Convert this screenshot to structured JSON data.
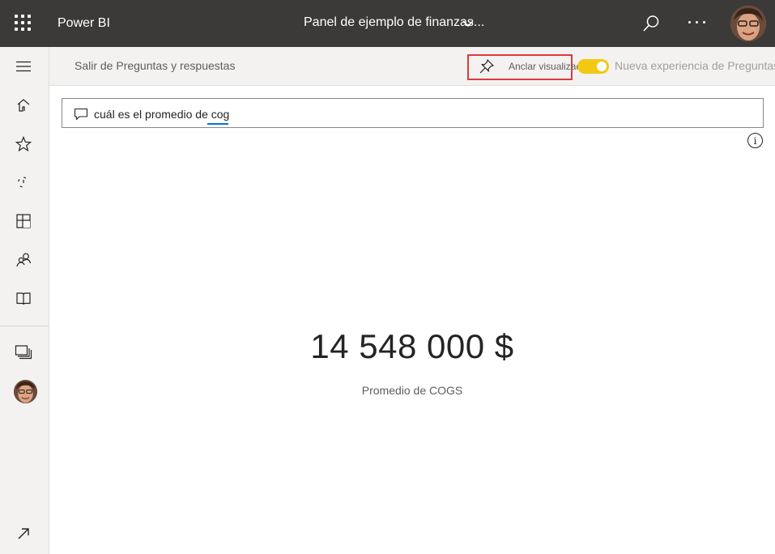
{
  "topbar": {
    "brand": "Power BI",
    "report_title": "Panel de ejemplo de finanzas...",
    "icons": [
      "waffle-icon",
      "chevron-down-icon",
      "search-icon",
      "more-icon",
      "avatar"
    ]
  },
  "leftnav": {
    "items": [
      {
        "name": "menu-icon"
      },
      {
        "name": "home-icon"
      },
      {
        "name": "star-icon"
      },
      {
        "name": "recent-icon"
      },
      {
        "name": "apps-icon"
      },
      {
        "name": "shared-icon"
      },
      {
        "name": "learn-icon"
      },
      {
        "name": "workspaces-icon"
      },
      {
        "name": "avatar"
      },
      {
        "name": "expand-icon"
      }
    ]
  },
  "cmdbar": {
    "exit_label": "Salir de Preguntas y respuestas",
    "pin_label": "Anclar visualización",
    "new_experience_label": "Nueva experiencia de Preguntas"
  },
  "qa": {
    "query": "cuál es el promedio de cog"
  },
  "result": {
    "value": "14 548 000 $",
    "caption": "Promedio de COGS"
  },
  "colors": {
    "topbar": "#3b3a39",
    "toggle": "#f2c811",
    "highlight": "#e0393e",
    "accent": "#0078d4"
  }
}
